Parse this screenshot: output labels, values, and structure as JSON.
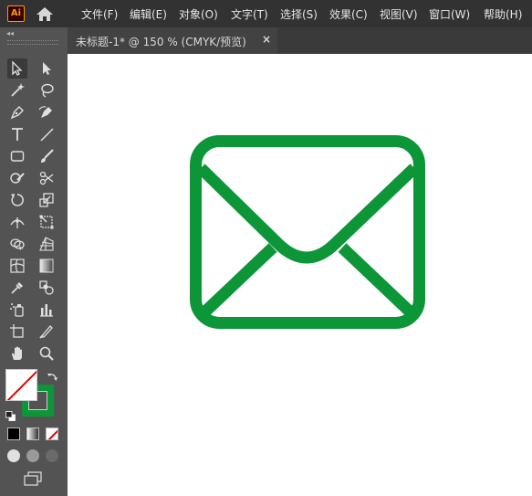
{
  "app": {
    "logo_text": "Ai",
    "accent": "#ff9a00"
  },
  "menu": [
    "文件(F)",
    "编辑(E)",
    "对象(O)",
    "文字(T)",
    "选择(S)",
    "效果(C)",
    "视图(V)",
    "窗口(W)",
    "帮助(H)"
  ],
  "panel": {
    "collapse_glyph": "◂◂"
  },
  "tab": {
    "title": "未标题-1* @ 150 % (CMYK/预览)",
    "close_glyph": "×"
  },
  "swatches": {
    "fill": "none",
    "stroke": "#0c9638"
  },
  "artwork": {
    "name": "mail-icon",
    "stroke_color": "#0c9638"
  },
  "tools": [
    "selection-tool-icon",
    "direct-selection-tool-icon",
    "magic-wand-tool-icon",
    "lasso-tool-icon",
    "pen-tool-icon",
    "curvature-tool-icon",
    "type-tool-icon",
    "line-segment-tool-icon",
    "rectangle-tool-icon",
    "paintbrush-tool-icon",
    "shaper-tool-icon",
    "scissors-tool-icon",
    "rotate-tool-icon",
    "scale-tool-icon",
    "width-tool-icon",
    "free-transform-tool-icon",
    "shape-builder-tool-icon",
    "perspective-grid-tool-icon",
    "mesh-tool-icon",
    "gradient-tool-icon",
    "eyedropper-tool-icon",
    "blend-tool-icon",
    "symbol-sprayer-tool-icon",
    "column-graph-tool-icon",
    "artboard-tool-icon",
    "slice-tool-icon",
    "hand-tool-icon",
    "zoom-tool-icon"
  ]
}
